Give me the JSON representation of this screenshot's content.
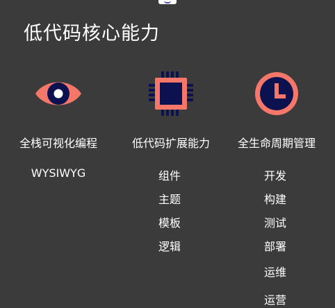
{
  "title": "低代码核心能力",
  "colors": {
    "background": "#3b3b3b",
    "accent": "#f4776a",
    "icon_dark": "#0c1250",
    "text": "#ffffff"
  },
  "columns": [
    {
      "icon": "eye-icon",
      "heading": "全栈可视化编程",
      "items": [
        "WYSIWYG"
      ]
    },
    {
      "icon": "chip-icon",
      "heading": "低代码扩展能力",
      "items": [
        "组件",
        "主题",
        "模板",
        "逻辑"
      ]
    },
    {
      "icon": "clock-icon",
      "heading": "全生命周期管理",
      "items": [
        "开发",
        "构建",
        "测试",
        "部署",
        "运维",
        "运营"
      ]
    }
  ]
}
